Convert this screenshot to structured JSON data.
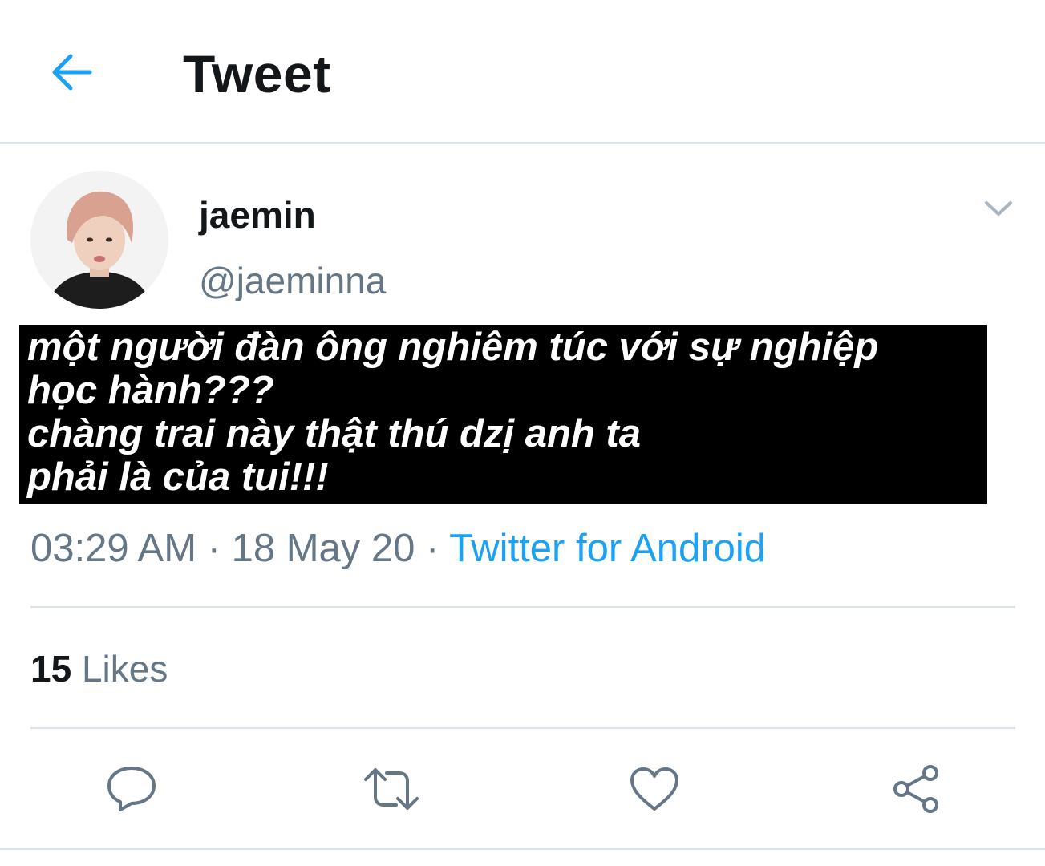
{
  "header": {
    "back_icon": "arrow-left-icon",
    "title": "Tweet"
  },
  "author": {
    "display_name": "jaemin",
    "handle": "@jaeminna",
    "menu_icon": "chevron-down-icon"
  },
  "tweet": {
    "lines": [
      "một người đàn ông nghiêm túc với sự nghiệp",
      "học hành???",
      "chàng trai này thật thú dzị anh ta",
      "phải là của tui!!!"
    ]
  },
  "meta": {
    "time": "03:29 AM",
    "separator": " · ",
    "date": "18 May 20",
    "source": "Twitter for Android"
  },
  "stats": {
    "likes_count": "15",
    "likes_label": "Likes"
  },
  "actions": [
    {
      "icon": "reply-icon"
    },
    {
      "icon": "retweet-icon"
    },
    {
      "icon": "heart-icon"
    },
    {
      "icon": "share-icon"
    }
  ],
  "colors": {
    "accent": "#1da1f2",
    "muted": "#657786",
    "divider": "#dbe4ec",
    "text": "#14171a"
  }
}
